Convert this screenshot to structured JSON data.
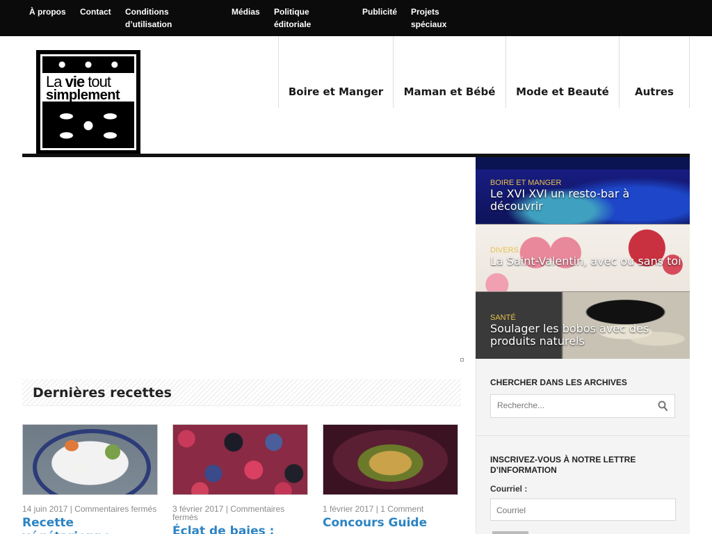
{
  "topnav": [
    "À propos",
    "Contact",
    "Conditions d’utilisation",
    "Médias",
    "Politique éditoriale",
    "Publicité",
    "Projets spéciaux"
  ],
  "logo": {
    "line1_a": "La ",
    "line1_b": "vie",
    "line1_c": " tout",
    "line2": "simplement"
  },
  "mainnav": [
    "Boire et Manger",
    "Maman et Bébé",
    "Mode et Beauté",
    "Autres"
  ],
  "features": [
    {
      "category": "Boire et Manger",
      "title": "Le XVI XVI un resto-bar à découvrir"
    },
    {
      "category": "Divers",
      "title": "La Saint-Valentin, avec ou sans toi"
    },
    {
      "category": "Santé",
      "title": "Soulager les bobos avec des produits naturels"
    }
  ],
  "recipes": {
    "heading": "Dernières recettes",
    "items": [
      {
        "date": "14 juin 2017",
        "comments": "Commentaires fermés",
        "title": "Recette végétarienne"
      },
      {
        "date": "3 février 2017",
        "comments": "Commentaires fermés",
        "title": "Éclat de baies :"
      },
      {
        "date": "1 février 2017",
        "comments": "1 Comment",
        "title": "Concours Guide"
      }
    ]
  },
  "sidebar": {
    "search_title": "Chercher dans les archives",
    "search_placeholder": "Recherche...",
    "newsletter_title": "Inscrivez-vous à notre lettre d’information",
    "email_label": "Courriel :",
    "email_placeholder": "Courriel"
  }
}
